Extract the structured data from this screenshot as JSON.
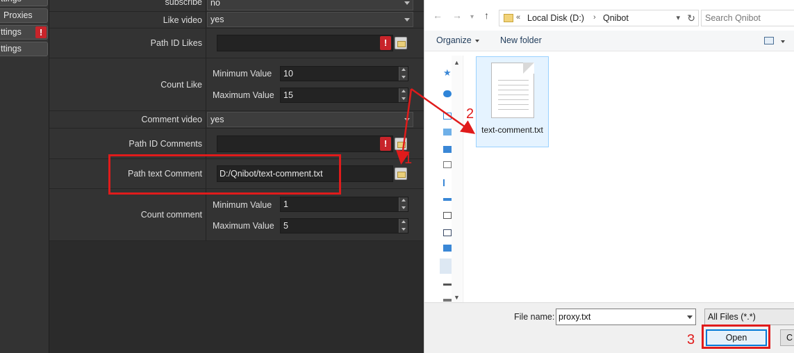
{
  "sidebar": {
    "items": [
      {
        "label": "ttings",
        "warning": false
      },
      {
        "label": "Proxies",
        "warning": false
      },
      {
        "label": "ttings",
        "warning": true,
        "warning_glyph": "!"
      },
      {
        "label": "ttings",
        "warning": false
      }
    ]
  },
  "form": {
    "subscribe": {
      "label": "subscribe",
      "value": "no"
    },
    "like_video": {
      "label": "Like video",
      "value": "yes"
    },
    "path_id_likes": {
      "label": "Path ID Likes",
      "value": "",
      "warning_glyph": "!"
    },
    "count_like": {
      "label": "Count Like",
      "min_label": "Minimum Value",
      "min_value": "10",
      "max_label": "Maximum Value",
      "max_value": "15"
    },
    "comment_video": {
      "label": "Comment video",
      "value": "yes"
    },
    "path_id_comments": {
      "label": "Path ID Comments",
      "value": "",
      "warning_glyph": "!"
    },
    "path_text_comment": {
      "label": "Path text Comment",
      "value": "D:/Qnibot/text-comment.txt"
    },
    "count_comment": {
      "label": "Count comment",
      "min_label": "Minimum Value",
      "min_value": "1",
      "max_label": "Maximum Value",
      "max_value": "5"
    }
  },
  "dialog": {
    "nav": {
      "back": "←",
      "forward": "→",
      "up": "↑"
    },
    "breadcrumb": {
      "prefix": "«",
      "drive": "Local Disk (D:)",
      "separator": "›",
      "folder": "Qnibot"
    },
    "search_placeholder": "Search Qnibot",
    "toolbar": {
      "organize": "Organize",
      "new_folder": "New folder"
    },
    "file": {
      "name": "text-comment.txt"
    },
    "filename_label": "File name:",
    "filename_value": "proxy.txt",
    "filter": "All Files (*.*)",
    "open_label": "Open",
    "cancel_label": "C"
  },
  "annotations": {
    "step1": "1",
    "step2": "2",
    "step3": "3"
  },
  "colors": {
    "annotation": "#e01b1b",
    "accent": "#0078d7",
    "warning": "#c8242a"
  }
}
